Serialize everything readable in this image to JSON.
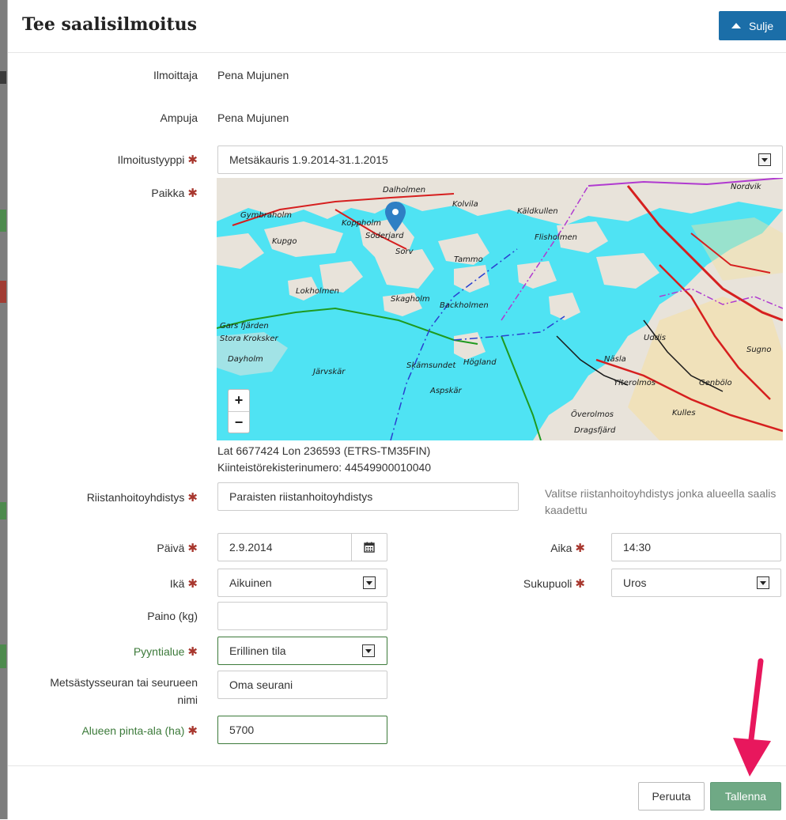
{
  "modal": {
    "title": "Tee saalisilmoitus",
    "close_label": "Sulje"
  },
  "form": {
    "reporter": {
      "label": "Ilmoittaja",
      "value": "Pena Mujunen"
    },
    "shooter": {
      "label": "Ampuja",
      "value": "Pena Mujunen"
    },
    "report_type": {
      "label": "Ilmoitustyyppi",
      "value": "Metsäkauris 1.9.2014-31.1.2015"
    },
    "place": {
      "label": "Paikka"
    },
    "coordinates": "Lat 6677424 Lon 236593 (ETRS-TM35FIN)",
    "property_id": "Kiinteistörekisterinumero: 44549900010040",
    "association": {
      "label": "Riistanhoitoyhdistys",
      "value": "Paraisten riistanhoitoyhdistys",
      "help": "Valitse riistanhoitoyhdistys jonka alueella saalis kaadettu"
    },
    "date": {
      "label": "Päivä",
      "value": "2.9.2014"
    },
    "time": {
      "label": "Aika",
      "value": "14:30"
    },
    "age": {
      "label": "Ikä",
      "value": "Aikuinen"
    },
    "gender": {
      "label": "Sukupuoli",
      "value": "Uros"
    },
    "weight": {
      "label": "Paino (kg)",
      "value": ""
    },
    "hunting_area": {
      "label": "Pyyntialue",
      "value": "Erillinen tila"
    },
    "club_name": {
      "label": "Metsästysseuran tai seurueen nimi",
      "value": "Oma seurani"
    },
    "area_size": {
      "label": "Alueen pinta-ala (ha)",
      "value": "5700"
    }
  },
  "map": {
    "zoom_in": "+",
    "zoom_out": "−",
    "places": [
      "Dalholmen",
      "Kolvila",
      "Käldkullen",
      "Nordvik",
      "Gymbraholm",
      "Koppholm",
      "Söderjard",
      "Flisholmen",
      "Kupgo",
      "Sorv",
      "Tammo",
      "Lokholmen",
      "Skagholm",
      "Backholmen",
      "Uddis",
      "Gars fjärden",
      "Stora Kroksker",
      "Dayholm",
      "Järvskär",
      "Skämsundet",
      "Högland",
      "Aspskär",
      "Näsla",
      "Ylterolmos",
      "Genbölo",
      "Kulles",
      "Dragsfjärd",
      "Överolmos",
      "Sugno"
    ]
  },
  "footer": {
    "cancel_label": "Peruuta",
    "save_label": "Tallenna"
  },
  "colors": {
    "header_button": "#1b6ea8",
    "save_button": "#6fa985",
    "required_mark": "#a8372e",
    "annotation_arrow": "#e8175d",
    "sea": "#4fe3f3"
  },
  "icons": {
    "close": "triangle-up-icon",
    "calendar": "calendar-icon",
    "marker": "map-marker-icon",
    "required": "asterisk-icon",
    "dropdown": "chevron-down-icon"
  }
}
